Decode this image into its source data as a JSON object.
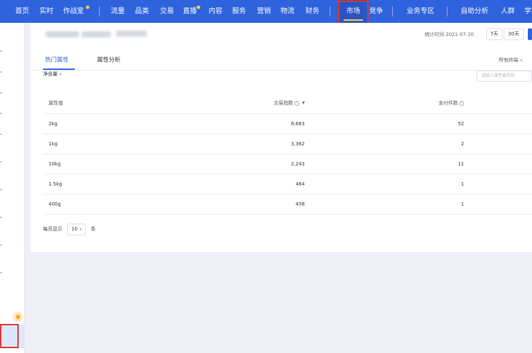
{
  "nav": {
    "items": [
      "首页",
      "实时",
      "作战室",
      "流量",
      "品类",
      "交易",
      "直播",
      "内容",
      "服务",
      "营销",
      "物流",
      "财务",
      "市场",
      "竞争",
      "业务专区",
      "自助分析",
      "人群",
      "学"
    ],
    "active": "市场"
  },
  "header": {
    "stat_time": "统计时间 2021-07-20",
    "ranges": [
      "7天",
      "30天"
    ]
  },
  "tabs": [
    "热门属性",
    "属性分析"
  ],
  "channel": "所有终端",
  "filter": {
    "pill": "净含量",
    "search_placeholder": "请输入属性值名称"
  },
  "table": {
    "headers": [
      "属性值",
      "交易指数",
      "支付件数"
    ],
    "rows": [
      [
        "2kg",
        "8,663",
        "52"
      ],
      [
        "1kg",
        "3,362",
        "2"
      ],
      [
        "10kg",
        "2,243",
        "11"
      ],
      [
        "1.5kg",
        "464",
        "1"
      ],
      [
        "400g",
        "458",
        "1"
      ]
    ]
  },
  "pager": {
    "prefix": "每页显示",
    "size": "10",
    "suffix": "条"
  },
  "colors": {
    "nav_bg": "#2f63dd",
    "accent": "#2f63dd",
    "highlight": "#e0352f",
    "badge": "#ffd43b"
  }
}
